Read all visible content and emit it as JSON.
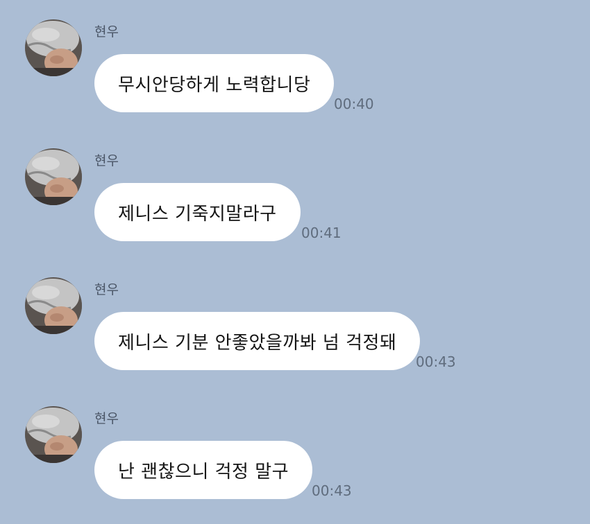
{
  "colors": {
    "background": "#abbdd4",
    "bubble": "#ffffff",
    "bubble_text": "#151515",
    "timestamp": "#5f6c7d",
    "sender": "#4a5566"
  },
  "messages": [
    {
      "sender": "현우",
      "avatar": "profile-photo",
      "text": "무시안당하게 노력합니당",
      "time": "00:40"
    },
    {
      "sender": "현우",
      "avatar": "profile-photo",
      "text": "제니스 기죽지말라구",
      "time": "00:41"
    },
    {
      "sender": "현우",
      "avatar": "profile-photo",
      "text": "제니스 기분 안좋았을까봐 넘 걱정돼",
      "time": "00:43"
    },
    {
      "sender": "현우",
      "avatar": "profile-photo",
      "text": "난 괜찮으니 걱정 말구",
      "time": "00:43"
    }
  ]
}
